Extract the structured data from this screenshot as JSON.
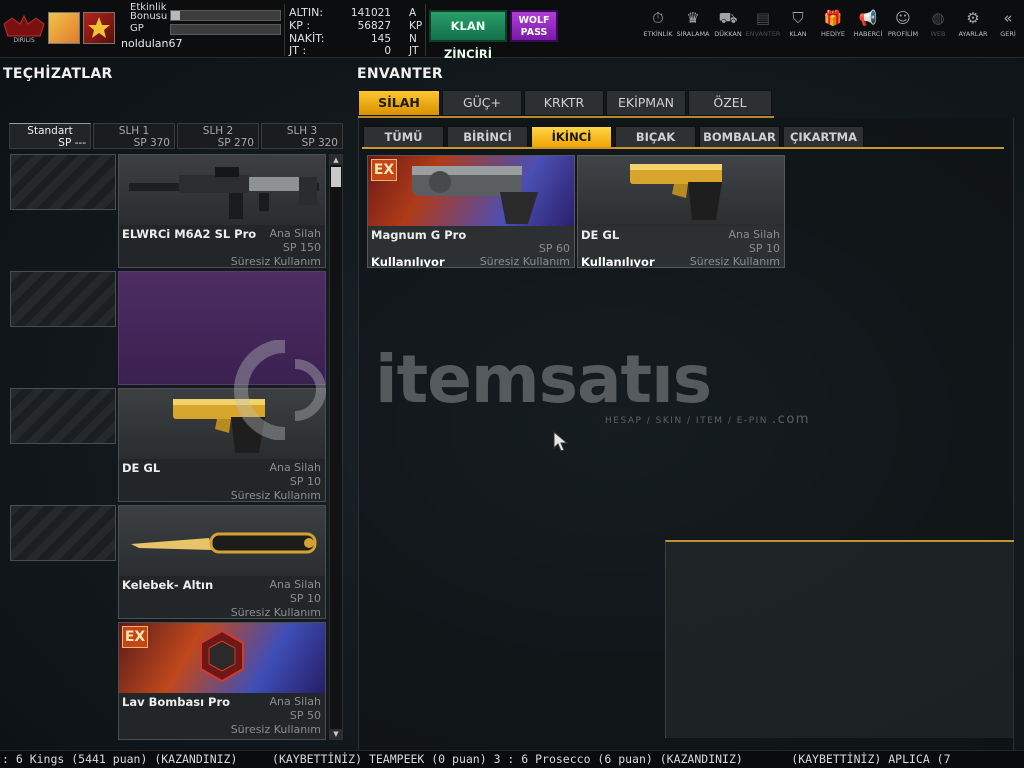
{
  "player": {
    "bonus_label_1": "Etkinlik",
    "bonus_label_2": "Bonusu",
    "gp_label": "GP",
    "username": "noldulan67",
    "bonus_progress": 0.08,
    "gp_progress": 0.0
  },
  "currencies": [
    {
      "label": "ALTIN:",
      "value": "141021",
      "unit": "A"
    },
    {
      "label": "KP  :",
      "value": "56827",
      "unit": "KP"
    },
    {
      "label": "NAKİT:",
      "value": "145",
      "unit": "N"
    },
    {
      "label": "JT  :",
      "value": "0",
      "unit": "JT"
    }
  ],
  "buttons": {
    "klan_zinciri": "KLAN ZİNCİRİ",
    "wolf_pass_1": "WOLF",
    "wolf_pass_2": "PASS"
  },
  "top_nav": [
    {
      "label": "ETKİNLİK",
      "icon": "stopwatch-icon",
      "glyph": "⏱",
      "active": true
    },
    {
      "label": "SIRALAMA",
      "icon": "medal-icon",
      "glyph": "♛",
      "active": true
    },
    {
      "label": "DÜKKAN",
      "icon": "cart-icon",
      "glyph": "⛟",
      "active": true
    },
    {
      "label": "ENVANTER",
      "icon": "inventory-icon",
      "glyph": "▤",
      "active": false
    },
    {
      "label": "KLAN",
      "icon": "shield-icon",
      "glyph": "⛉",
      "active": true
    },
    {
      "label": "HEDİYE",
      "icon": "gift-icon",
      "glyph": "🎁",
      "active": true
    },
    {
      "label": "HABERCİ",
      "icon": "megaphone-icon",
      "glyph": "📢",
      "active": true
    },
    {
      "label": "PROFİLİM",
      "icon": "profile-icon",
      "glyph": "☺",
      "active": true
    },
    {
      "label": "WEB",
      "icon": "globe-icon",
      "glyph": "◍",
      "active": false
    },
    {
      "label": "AYARLAR",
      "icon": "gear-icon",
      "glyph": "⚙",
      "active": true
    },
    {
      "label": "GERİ",
      "icon": "back-icon",
      "glyph": "«",
      "active": true
    }
  ],
  "left": {
    "title": "TEÇHİZATLAR",
    "slot_tabs": [
      {
        "name": "Standart",
        "sp": "SP ---",
        "active": true
      },
      {
        "name": "SLH 1",
        "sp": "SP 370",
        "active": false
      },
      {
        "name": "SLH 2",
        "sp": "SP 270",
        "active": false
      },
      {
        "name": "SLH 3",
        "sp": "SP 320",
        "active": false
      }
    ],
    "equipped": [
      {
        "name": "ELWRCi M6A2 SL Pro",
        "type": "Ana Silah",
        "sp": "SP 150",
        "duration": "Süresiz Kullanım"
      },
      {
        "name": "",
        "type": "",
        "sp": "",
        "duration": ""
      },
      {
        "name": "DE GL",
        "type": "Ana Silah",
        "sp": "SP 10",
        "duration": "Süresiz Kullanım"
      },
      {
        "name": "Kelebek- Altın",
        "type": "Ana Silah",
        "sp": "SP 10",
        "duration": "Süresiz Kullanım"
      },
      {
        "name": "Lav Bombası Pro",
        "type": "Ana Silah",
        "sp": "SP 50",
        "duration": "Süresiz Kullanım",
        "ex": "EX"
      }
    ]
  },
  "right": {
    "title": "ENVANTER",
    "tabs": [
      {
        "label": "SİLAH",
        "active": true
      },
      {
        "label": "GÜÇ+",
        "active": false
      },
      {
        "label": "KRKTR",
        "active": false
      },
      {
        "label": "EKİPMAN",
        "active": false
      },
      {
        "label": "ÖZEL",
        "active": false
      }
    ],
    "subtabs": [
      {
        "label": "TÜMÜ",
        "active": false
      },
      {
        "label": "BİRİNCİ",
        "active": false
      },
      {
        "label": "İKİNCİ",
        "active": true
      },
      {
        "label": "BIÇAK",
        "active": false
      },
      {
        "label": "BOMBALAR",
        "active": false
      },
      {
        "label": "ÇIKARTMA",
        "active": false
      }
    ],
    "items": [
      {
        "name": "Magnum G Pro",
        "sp": "SP 60",
        "status": "Kullanılıyor",
        "duration": "Süresiz Kullanım",
        "ex": "EX",
        "type": ""
      },
      {
        "name": "DE GL",
        "type": "Ana Silah",
        "sp": "SP 10",
        "status": "Kullanılıyor",
        "duration": "Süresiz Kullanım"
      }
    ]
  },
  "watermark": {
    "text": "itemsatıs",
    "sub": "HESAP / SKIN / ITEM / E-PIN",
    "suffix": ".com"
  },
  "ticker": ": 6 Kings (5441 puan) (KAZANDINIZ)     (KAYBETTİNİZ) TEAMPEEK (0 puan) 3 : 6 Prosecco (6 puan) (KAZANDINIZ)       (KAYBETTİNİZ) APLICA (7",
  "colors": {
    "accent": "#f5b400",
    "klan_button": "#1e8a5c",
    "wolf_button": "#9b2fc9",
    "ex_tag": "#c5451b"
  }
}
